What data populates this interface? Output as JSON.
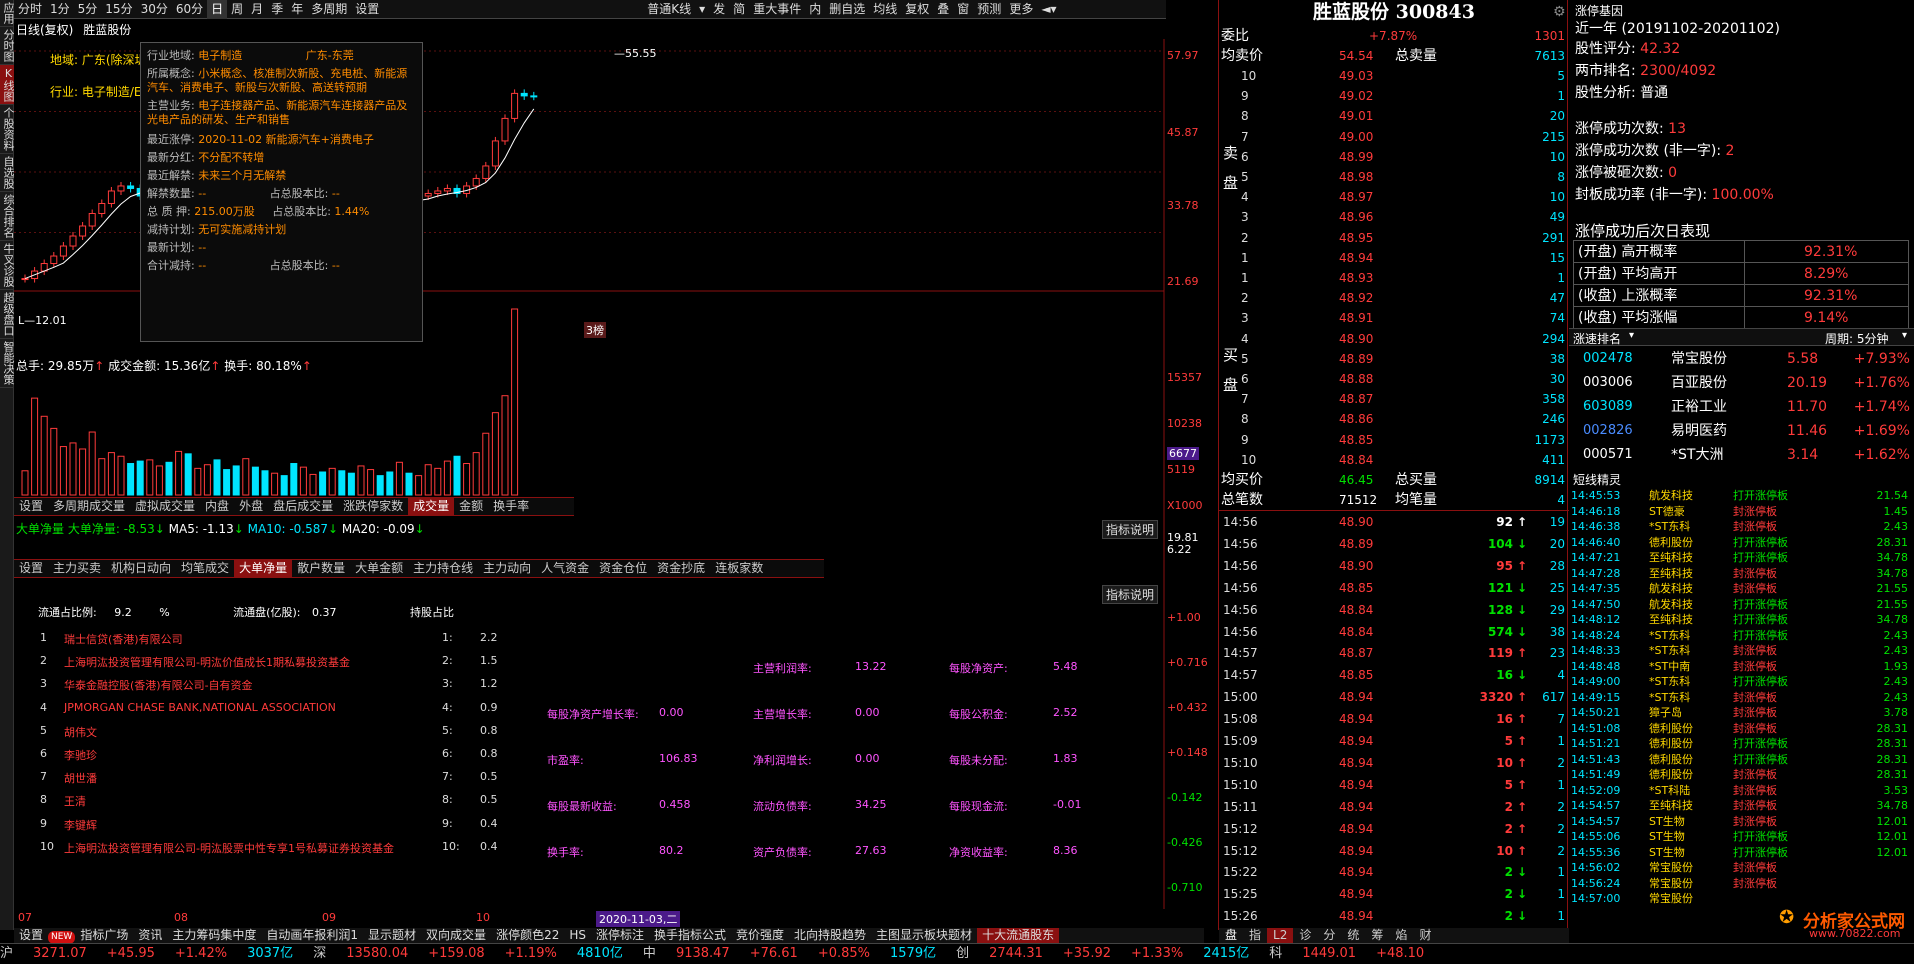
{
  "left_bar": [
    "应用",
    "分时图",
    "K线图",
    "个股资料",
    "自选股",
    "综合排名",
    "牛叉诊股",
    "超级盘口",
    "智能决策"
  ],
  "top_bar": {
    "periods": [
      "分时",
      "1分",
      "5分",
      "15分",
      "30分",
      "60分",
      "日",
      "周",
      "月",
      "季",
      "年",
      "多周期",
      "设置"
    ],
    "active_period": "日",
    "kline_type": "普通K线",
    "tools": [
      "发",
      "简",
      "重大事件",
      "内",
      "删自选",
      "均线",
      "复权",
      "叠",
      "窗",
      "预测",
      "更多"
    ]
  },
  "chart_header": {
    "title": "日线(复权)",
    "stock": "胜蓝股份"
  },
  "chart_labels": {
    "region": "地域: 广东(除深圳)",
    "industry": "行业: 电子制造/E"
  },
  "price_axis": [
    "57.97",
    "45.87",
    "33.78",
    "21.69"
  ],
  "high_label": "55.55",
  "low_label": "12.01",
  "tooltip": {
    "industry_region": {
      "label": "行业地域:",
      "industry": "电子制造",
      "region": "广东-东莞"
    },
    "concepts": {
      "label": "所属概念:",
      "value": "小米概念、核准制次新股、充电桩、新能源汽车、消费电子、新股与次新股、高送转预期"
    },
    "business": {
      "label": "主营业务:",
      "value": "电子连接器产品、新能源汽车连接器产品及光电产品的研发、生产和销售"
    },
    "limit_up": {
      "label": "最近涨停:",
      "value": "2020-11-02 新能源汽车+消费电子"
    },
    "dividend": {
      "label": "最新分红:",
      "value": "不分配不转增"
    },
    "unlock": {
      "label": "最近解禁:",
      "value": "未来三个月无解禁"
    },
    "unlock_qty": {
      "label": "解禁数量:",
      "value": "--",
      "ratio_label": "占总股本比:",
      "ratio": "--"
    },
    "pledge": {
      "label": "总 质 押:",
      "value": "215.00万股",
      "ratio_label": "占总股本比:",
      "ratio": "1.44%"
    },
    "reduce_plan": {
      "label": "减持计划:",
      "value": "无可实施减持计划"
    },
    "latest_plan": {
      "label": "最新计划:",
      "value": "--"
    },
    "total_reduce": {
      "label": "合计减持:",
      "value": "--",
      "ratio_label": "占总股本比:",
      "ratio": "--"
    }
  },
  "badge": "3榜",
  "volume_header": {
    "hands": "总手: 29.85万",
    "amount": "成交金额: 15.36亿",
    "turnover": "换手: 80.18%"
  },
  "volume_axis": [
    "15357",
    "10238",
    "6677",
    "5119",
    "X1000"
  ],
  "volume_tabs": [
    "设置",
    "多周期成交量",
    "虚拟成交量",
    "内盘",
    "外盘",
    "盘后成交量",
    "涨跌停家数",
    "成交量",
    "金额",
    "换手率"
  ],
  "volume_active": "成交量",
  "bigorder_header": {
    "name": "大单净量",
    "value": "大单净量: -8.53",
    "ma5": "MA5: -1.13",
    "ma10": "MA10: -0.587",
    "ma20": "MA20: -0.09"
  },
  "bigorder_axis": [
    "19.81",
    "6.22"
  ],
  "indicator_btn": "指标说明",
  "indicator_tabs": [
    "设置",
    "主力买卖",
    "机构日动向",
    "均笔成交",
    "大单净量",
    "散户数量",
    "大单金额",
    "主力持仓线",
    "主力动向",
    "人气资金",
    "资金仓位",
    "资金抄底",
    "连板家数"
  ],
  "indicator_active": "大单净量",
  "holders": {
    "float_ratio_label": "流通占比例:",
    "float_ratio": "9.2",
    "pct": "%",
    "float_cap_label": "流通盘(亿股):",
    "float_cap": "0.37",
    "hold_ratio_label": "持股占比",
    "rows": [
      {
        "n": "1",
        "name": "瑞士信贷(香港)有限公司",
        "idx": "1:",
        "v": "2.2"
      },
      {
        "n": "2",
        "name": "上海明汯投资管理有限公司-明汯价值成长1期私募投资基金",
        "idx": "2:",
        "v": "1.5"
      },
      {
        "n": "3",
        "name": "华泰金融控股(香港)有限公司-自有资金",
        "idx": "3:",
        "v": "1.2"
      },
      {
        "n": "4",
        "name": "JPMORGAN CHASE BANK,NATIONAL ASSOCIATION",
        "idx": "4:",
        "v": "0.9"
      },
      {
        "n": "5",
        "name": "胡伟文",
        "idx": "5:",
        "v": "0.8"
      },
      {
        "n": "6",
        "name": "李驰珍",
        "idx": "6:",
        "v": "0.8"
      },
      {
        "n": "7",
        "name": "胡世潘",
        "idx": "7:",
        "v": "0.5"
      },
      {
        "n": "8",
        "name": "王清",
        "idx": "8:",
        "v": "0.5"
      },
      {
        "n": "9",
        "name": "李键辉",
        "idx": "9:",
        "v": "0.4"
      },
      {
        "n": "10",
        "name": "上海明汯投资管理有限公司-明汯股票中性专享1号私募证券投资基金",
        "idx": "10:",
        "v": "0.4"
      }
    ]
  },
  "finance": [
    {
      "label": "主营利润率:",
      "value": "13.22",
      "label2": "每股净资产:",
      "value2": "5.48"
    },
    {
      "label0": "每股净资产增长率:",
      "value0": "0.00",
      "label": "主营增长率:",
      "value": "0.00",
      "label2": "每股公积金:",
      "value2": "2.52"
    },
    {
      "label0": "市盈率:",
      "value0": "106.83",
      "label": "净利润增长:",
      "value": "0.00",
      "label2": "每股未分配:",
      "value2": "1.83"
    },
    {
      "label0": "每股最新收益:",
      "value0": "0.458",
      "label": "流动负债率:",
      "value": "34.25",
      "label2": "每股现金流:",
      "value2": "-0.01"
    },
    {
      "label0": "换手率:",
      "value0": "80.2",
      "label": "资产负债率:",
      "value": "27.63",
      "label2": "净资收益率:",
      "value2": "8.36"
    }
  ],
  "right_axis": [
    "+1.00",
    "+0.716",
    "+0.432",
    "+0.148",
    "-0.142",
    "-0.426",
    "-0.710"
  ],
  "date_axis": [
    "07",
    "08",
    "09",
    "10",
    "2020-11-03,二"
  ],
  "bottom_tabs": [
    "设置",
    "指标广场",
    "资讯",
    "主力筹码集中度",
    "自动画年报利润1",
    "显示题材",
    "双向成交量",
    "涨停颜色22",
    "HS",
    "涨停标注",
    "换手指标公式",
    "竞价强度",
    "北向持股趋势",
    "主图显示板块题材",
    "十大流通股东"
  ],
  "bottom_new": "NEW",
  "bottom_active": "十大流通股东",
  "quote": {
    "title": "胜蓝股份 300843",
    "wb_label": "委比",
    "wb_pct": "+7.87%",
    "wb_val": "1301",
    "avg_sell_label": "均卖价",
    "avg_sell": "54.54",
    "total_sell_label": "总卖量",
    "total_sell": "7613",
    "sell_side": "卖盘",
    "buy_side": "买盘",
    "sells": [
      {
        "lv": "10",
        "p": "49.03",
        "v": "5"
      },
      {
        "lv": "9",
        "p": "49.02",
        "v": "1"
      },
      {
        "lv": "8",
        "p": "49.01",
        "v": "20"
      },
      {
        "lv": "7",
        "p": "49.00",
        "v": "215"
      },
      {
        "lv": "6",
        "p": "48.99",
        "v": "10"
      },
      {
        "lv": "5",
        "p": "48.98",
        "v": "8"
      },
      {
        "lv": "4",
        "p": "48.97",
        "v": "10"
      },
      {
        "lv": "3",
        "p": "48.96",
        "v": "49"
      },
      {
        "lv": "2",
        "p": "48.95",
        "v": "291"
      },
      {
        "lv": "1",
        "p": "48.94",
        "v": "15"
      }
    ],
    "buys": [
      {
        "lv": "1",
        "p": "48.93",
        "v": "1"
      },
      {
        "lv": "2",
        "p": "48.92",
        "v": "47"
      },
      {
        "lv": "3",
        "p": "48.91",
        "v": "74"
      },
      {
        "lv": "4",
        "p": "48.90",
        "v": "294"
      },
      {
        "lv": "5",
        "p": "48.89",
        "v": "38"
      },
      {
        "lv": "6",
        "p": "48.88",
        "v": "30"
      },
      {
        "lv": "7",
        "p": "48.87",
        "v": "358"
      },
      {
        "lv": "8",
        "p": "48.86",
        "v": "246"
      },
      {
        "lv": "9",
        "p": "48.85",
        "v": "1173"
      },
      {
        "lv": "10",
        "p": "48.84",
        "v": "411"
      }
    ],
    "avg_buy_label": "均买价",
    "avg_buy": "46.45",
    "total_buy_label": "总买量",
    "total_buy": "8914",
    "total_count_label": "总笔数",
    "total_count": "71512",
    "avg_count_label": "均笔量",
    "avg_count": "4",
    "ticks": [
      {
        "t": "14:56",
        "p": "48.90",
        "v": "92",
        "d": "up",
        "n": "19",
        "pc": "r",
        "vc": "w"
      },
      {
        "t": "14:56",
        "p": "48.89",
        "v": "104",
        "d": "down",
        "n": "20",
        "pc": "r",
        "vc": "g"
      },
      {
        "t": "14:56",
        "p": "48.90",
        "v": "95",
        "d": "up",
        "n": "28",
        "pc": "r",
        "vc": "r"
      },
      {
        "t": "14:56",
        "p": "48.85",
        "v": "121",
        "d": "down",
        "n": "25",
        "pc": "r",
        "vc": "g"
      },
      {
        "t": "14:56",
        "p": "48.84",
        "v": "128",
        "d": "down",
        "n": "29",
        "pc": "r",
        "vc": "g"
      },
      {
        "t": "14:56",
        "p": "48.84",
        "v": "574",
        "d": "down",
        "n": "38",
        "pc": "r",
        "vc": "g"
      },
      {
        "t": "14:57",
        "p": "48.87",
        "v": "119",
        "d": "up",
        "n": "23",
        "pc": "r",
        "vc": "r"
      },
      {
        "t": "14:57",
        "p": "48.85",
        "v": "16",
        "d": "down",
        "n": "4",
        "pc": "r",
        "vc": "g"
      },
      {
        "t": "15:00",
        "p": "48.94",
        "v": "3320",
        "d": "up",
        "n": "617",
        "pc": "r",
        "vc": "r"
      },
      {
        "t": "15:08",
        "p": "48.94",
        "v": "16",
        "d": "up",
        "n": "7",
        "pc": "r",
        "vc": "r"
      },
      {
        "t": "15:09",
        "p": "48.94",
        "v": "5",
        "d": "up",
        "n": "1",
        "pc": "r",
        "vc": "r"
      },
      {
        "t": "15:10",
        "p": "48.94",
        "v": "10",
        "d": "up",
        "n": "2",
        "pc": "r",
        "vc": "r"
      },
      {
        "t": "15:10",
        "p": "48.94",
        "v": "5",
        "d": "up",
        "n": "1",
        "pc": "r",
        "vc": "r"
      },
      {
        "t": "15:11",
        "p": "48.94",
        "v": "2",
        "d": "up",
        "n": "2",
        "pc": "r",
        "vc": "r"
      },
      {
        "t": "15:12",
        "p": "48.94",
        "v": "2",
        "d": "up",
        "n": "2",
        "pc": "r",
        "vc": "r"
      },
      {
        "t": "15:12",
        "p": "48.94",
        "v": "10",
        "d": "up",
        "n": "2",
        "pc": "r",
        "vc": "r"
      },
      {
        "t": "15:22",
        "p": "48.94",
        "v": "2",
        "d": "down",
        "n": "1",
        "pc": "r",
        "vc": "g"
      },
      {
        "t": "15:25",
        "p": "48.94",
        "v": "2",
        "d": "down",
        "n": "1",
        "pc": "r",
        "vc": "g"
      },
      {
        "t": "15:26",
        "p": "48.94",
        "v": "2",
        "d": "down",
        "n": "1",
        "pc": "r",
        "vc": "g"
      }
    ],
    "bottom_tabs": [
      "盘",
      "指",
      "L2",
      "诊",
      "分",
      "统",
      "筹",
      "焰",
      "财"
    ]
  },
  "right": {
    "title": "涨停基因",
    "period": "近一年 (20191102-20201102)",
    "score_label": "股性评分:",
    "score": "42.32",
    "rank_label": "两市排名:",
    "rank": "2300/4092",
    "analysis_label": "股性分析:",
    "analysis": "普通",
    "success_label": "涨停成功次数:",
    "success": "13",
    "success_nz_label": "涨停成功次数 (非一字):",
    "success_nz": "2",
    "broken_label": "涨停被砸次数:",
    "broken": "0",
    "seal_label": "封板成功率 (非一字):",
    "seal": "100.00%",
    "next_title": "涨停成功后次日表现",
    "next": [
      {
        "label": "(开盘) 高开概率",
        "value": "92.31%"
      },
      {
        "label": "(开盘) 平均高开",
        "value": "8.29%"
      },
      {
        "label": "(收盘) 上涨概率",
        "value": "92.31%"
      },
      {
        "label": "(收盘) 平均涨幅",
        "value": "9.14%"
      }
    ],
    "speed_label": "涨速排名",
    "speed_period": "周期: 5分钟",
    "speed": [
      {
        "code": "002478",
        "name": "常宝股份",
        "price": "5.58",
        "pct": "+7.93%",
        "cc": "c"
      },
      {
        "code": "003006",
        "name": "百亚股份",
        "price": "20.19",
        "pct": "+1.76%",
        "cc": "w"
      },
      {
        "code": "603089",
        "name": "正裕工业",
        "price": "11.70",
        "pct": "+1.74%",
        "cc": "c"
      },
      {
        "code": "002826",
        "name": "易明医药",
        "price": "11.46",
        "pct": "+1.69%",
        "cc": "b"
      },
      {
        "code": "000571",
        "name": "*ST大洲",
        "price": "3.14",
        "pct": "+1.62%",
        "cc": "w"
      }
    ],
    "short_title": "短线精灵",
    "short": [
      {
        "t": "14:45:53",
        "n": "航发科技",
        "e": "打开涨停板",
        "v": "21.54",
        "ec": "g"
      },
      {
        "t": "14:46:18",
        "n": "ST德豪",
        "e": "封涨停板",
        "v": "1.45",
        "ec": "r"
      },
      {
        "t": "14:46:38",
        "n": "*ST东科",
        "e": "封涨停板",
        "v": "2.43",
        "ec": "r"
      },
      {
        "t": "14:46:40",
        "n": "德利股份",
        "e": "打开涨停板",
        "v": "28.31",
        "ec": "g"
      },
      {
        "t": "14:47:21",
        "n": "至纯科技",
        "e": "打开涨停板",
        "v": "34.78",
        "ec": "g"
      },
      {
        "t": "14:47:28",
        "n": "至纯科技",
        "e": "封涨停板",
        "v": "34.78",
        "ec": "r"
      },
      {
        "t": "14:47:35",
        "n": "航发科技",
        "e": "封涨停板",
        "v": "21.55",
        "ec": "r"
      },
      {
        "t": "14:47:50",
        "n": "航发科技",
        "e": "打开涨停板",
        "v": "21.55",
        "ec": "g"
      },
      {
        "t": "14:48:12",
        "n": "至纯科技",
        "e": "打开涨停板",
        "v": "34.78",
        "ec": "g"
      },
      {
        "t": "14:48:24",
        "n": "*ST东科",
        "e": "打开涨停板",
        "v": "2.43",
        "ec": "g"
      },
      {
        "t": "14:48:33",
        "n": "*ST东科",
        "e": "封涨停板",
        "v": "2.43",
        "ec": "r"
      },
      {
        "t": "14:48:48",
        "n": "*ST中南",
        "e": "封涨停板",
        "v": "1.93",
        "ec": "r"
      },
      {
        "t": "14:49:00",
        "n": "*ST东科",
        "e": "打开涨停板",
        "v": "2.43",
        "ec": "g"
      },
      {
        "t": "14:49:15",
        "n": "*ST东科",
        "e": "封涨停板",
        "v": "2.43",
        "ec": "r"
      },
      {
        "t": "14:50:21",
        "n": "獐子岛",
        "e": "封涨停板",
        "v": "3.78",
        "ec": "r"
      },
      {
        "t": "14:51:08",
        "n": "德利股份",
        "e": "封涨停板",
        "v": "28.31",
        "ec": "r"
      },
      {
        "t": "14:51:21",
        "n": "德利股份",
        "e": "打开涨停板",
        "v": "28.31",
        "ec": "g"
      },
      {
        "t": "14:51:43",
        "n": "德利股份",
        "e": "打开涨停板",
        "v": "28.31",
        "ec": "g"
      },
      {
        "t": "14:51:49",
        "n": "德利股份",
        "e": "封涨停板",
        "v": "28.31",
        "ec": "r"
      },
      {
        "t": "14:52:09",
        "n": "*ST科陆",
        "e": "封涨停板",
        "v": "3.53",
        "ec": "r"
      },
      {
        "t": "14:54:57",
        "n": "至纯科技",
        "e": "封涨停板",
        "v": "34.78",
        "ec": "r"
      },
      {
        "t": "14:54:57",
        "n": "ST生物",
        "e": "封涨停板",
        "v": "12.01",
        "ec": "r"
      },
      {
        "t": "14:55:06",
        "n": "ST生物",
        "e": "打开涨停板",
        "v": "12.01",
        "ec": "g"
      },
      {
        "t": "14:55:36",
        "n": "ST生物",
        "e": "打开涨停板",
        "v": "12.01",
        "ec": "g"
      },
      {
        "t": "14:56:02",
        "n": "常宝股份",
        "e": "封涨停板",
        "v": "",
        "ec": "r"
      },
      {
        "t": "14:56:24",
        "n": "常宝股份",
        "e": "封涨停板",
        "v": "",
        "ec": "r"
      },
      {
        "t": "14:57:00",
        "n": "常宝股份",
        "e": "",
        "v": "",
        "ec": "r"
      }
    ]
  },
  "watermark": {
    "name": "分析家公式网",
    "url": "www.70822.com"
  },
  "status": [
    {
      "label": "沪",
      "v1": "3271.07",
      "v2": "+45.95",
      "v3": "+1.42%",
      "v4": "3037亿"
    },
    {
      "label": "深",
      "v1": "13580.04",
      "v2": "+159.08",
      "v3": "+1.19%",
      "v4": "4810亿"
    },
    {
      "label": "中",
      "v1": "9138.47",
      "v2": "+76.61",
      "v3": "+0.85%",
      "v4": "1579亿"
    },
    {
      "label": "创",
      "v1": "2744.31",
      "v2": "+35.92",
      "v3": "+1.33%",
      "v4": "2415亿"
    },
    {
      "label": "科",
      "v1": "1449.01",
      "v2": "+48.10",
      "v3": "",
      "v4": ""
    }
  ],
  "chart_data": {
    "type": "candlestick",
    "price_ylim": [
      12.01,
      57.97
    ],
    "close": [
      12.5,
      14,
      15.5,
      17,
      19,
      21,
      23,
      25.5,
      27.5,
      30,
      31,
      30.5,
      29,
      30,
      31,
      29.5,
      30.5,
      29,
      30,
      31,
      30,
      29,
      28.5,
      30,
      29,
      28,
      29.5,
      28,
      27,
      28.5,
      29,
      28,
      29.5,
      28,
      27.5,
      28,
      29,
      28,
      27,
      28.5,
      28,
      29,
      29.5,
      30,
      30.5,
      29.5,
      31,
      32.5,
      35,
      40,
      44.5,
      49.5,
      49,
      48.94
    ],
    "volume": [
      2.0,
      8.0,
      6.5,
      5.5,
      4.0,
      4.3,
      3.8,
      5.2,
      3.0,
      3.5,
      3.2,
      2.6,
      2.8,
      2.9,
      2.4,
      2.7,
      3.6,
      3.4,
      2.2,
      2.5,
      2.9,
      2.1,
      2.4,
      3.0,
      2.3,
      2.0,
      1.8,
      1.6,
      2.6,
      2.3,
      1.7,
      1.9,
      2.2,
      2.0,
      1.8,
      2.4,
      2.1,
      1.6,
      1.9,
      2.7,
      1.8,
      1.6,
      2.5,
      2.2,
      2.8,
      3.2,
      2.6,
      3.5,
      5.1,
      6.8,
      8.2,
      15.36
    ]
  }
}
